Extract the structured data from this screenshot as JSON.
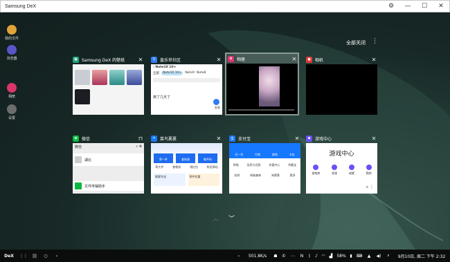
{
  "window": {
    "title": "Samsung DeX"
  },
  "desktop_icons": [
    {
      "label": "我的文件",
      "color": "#e0a43a"
    },
    {
      "label": "浏览器",
      "color": "#5b55c9"
    },
    {
      "label": "相册",
      "color": "#d9366b"
    },
    {
      "label": "设置",
      "color": "#6d6d6d"
    }
  ],
  "recents": {
    "close_all": "全部关闭",
    "cards": [
      {
        "name": "Samsung DeX 的壁纸",
        "icon_color": "#1fa37b"
      },
      {
        "name": "盖乐世社区",
        "icon_color": "#2f7cf6"
      },
      {
        "name": "相册",
        "icon_color": "#d9366b"
      },
      {
        "name": "相机",
        "icon_color": "#e53935"
      },
      {
        "name": "微信",
        "icon_color": "#09b83e"
      },
      {
        "name": "菜鸟裹裹",
        "icon_color": "#1677ff"
      },
      {
        "name": "支付宝",
        "icon_color": "#1677ff"
      },
      {
        "name": "游戏中心",
        "icon_color": "#6c4ff6"
      }
    ],
    "community": {
      "topic": "Note10 10+",
      "tabs": [
        "全部",
        "Note10 10+",
        "Note9",
        "Note8"
      ],
      "post_title": "离了几天了",
      "reply": "发表"
    },
    "wechat": {
      "title": "微信",
      "chats": [
        "湖北",
        "文件传输助手"
      ]
    },
    "cainiao": {
      "tiles": [
        "寄一件",
        "查快递",
        "取件码"
      ],
      "actions": [
        "寄大件",
        "查物流",
        "领红包",
        "附近驿站"
      ],
      "banners": [
        "裹裹专送",
        "寄件优惠"
      ]
    },
    "alipay": {
      "row1": [
        "扫一扫",
        "付钱",
        "收钱",
        "卡包"
      ],
      "row2": [
        "转账",
        "信用卡还款",
        "充值中心",
        "余额宝"
      ],
      "row3": [
        "花呗",
        "蚂蚁森林",
        "淘票票",
        "更多"
      ]
    },
    "game_center": {
      "title": "游戏中心",
      "buttons": [
        "游戏库",
        "发现",
        "成就",
        "我的"
      ]
    }
  },
  "taskbar": {
    "dex": "DeX",
    "speed": "501.8K/s",
    "battery": "58%",
    "datetime": "9月10日, 周二 下午 2:32"
  }
}
